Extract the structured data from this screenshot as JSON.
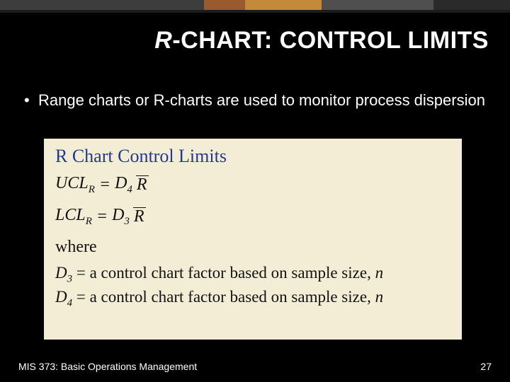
{
  "title": {
    "italic": "R",
    "rest": "-CHART: CONTROL LIMITS"
  },
  "bullet": "Range charts or R-charts are used to monitor process dispersion",
  "formula": {
    "heading": "R Chart Control Limits",
    "ucl_lhs": "UCL",
    "ucl_sub": "R",
    "eq": "=",
    "ucl_coef": "D",
    "ucl_coef_sub": "4",
    "rbar": "R",
    "lcl_lhs": "LCL",
    "lcl_sub": "R",
    "lcl_coef": "D",
    "lcl_coef_sub": "3",
    "where": "where",
    "d3_var": "D",
    "d3_sub": "3",
    "d3_text": " = a control chart factor based on sample size, ",
    "d3_n": "n",
    "d4_var": "D",
    "d4_sub": "4",
    "d4_text": " = a control chart factor based on sample size, ",
    "d4_n": "n"
  },
  "footer": {
    "course": "MIS 373: Basic Operations Management",
    "page": "27"
  }
}
